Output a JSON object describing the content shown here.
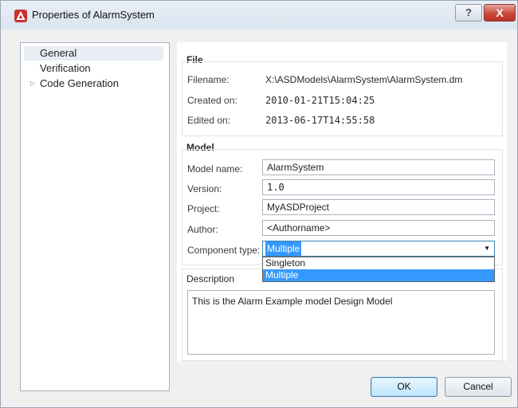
{
  "window": {
    "title": "Properties of AlarmSystem",
    "help_label": "?",
    "close_label": "X"
  },
  "sidebar": {
    "items": [
      {
        "label": "General"
      },
      {
        "label": "Verification"
      },
      {
        "label": "Code Generation"
      }
    ]
  },
  "file": {
    "title": "File",
    "filename_label": "Filename:",
    "filename": "X:\\ASDModels\\AlarmSystem\\AlarmSystem.dm",
    "created_label": "Created on:",
    "created": "2010-01-21T15:04:25",
    "edited_label": "Edited on:",
    "edited": "2013-06-17T14:55:58"
  },
  "model": {
    "title": "Model",
    "name_label": "Model name:",
    "name": "AlarmSystem",
    "version_label": "Version:",
    "version": "1.0",
    "project_label": "Project:",
    "project": "MyASDProject",
    "author_label": "Author:",
    "author": "<Authorname>",
    "component_type_label": "Component type:",
    "component_type": "Multiple",
    "component_type_options": [
      "Singleton",
      "Multiple"
    ]
  },
  "description": {
    "title": "Description",
    "text": "This is the Alarm Example model Design Model"
  },
  "buttons": {
    "ok": "OK",
    "cancel": "Cancel"
  }
}
